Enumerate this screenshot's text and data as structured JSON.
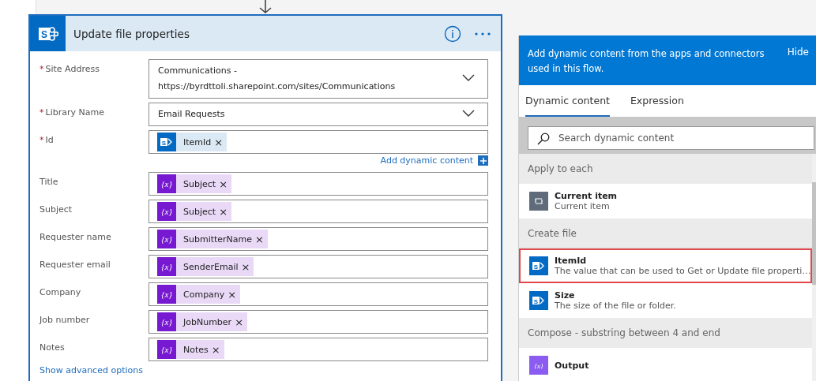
{
  "card": {
    "title": "Update file properties",
    "icon": "S",
    "fields": [
      {
        "label": "Site Address",
        "required_mark": "*",
        "kind": "dropdown",
        "lines": [
          "Communications -",
          "https://byrdttoli.sharepoint.com/sites/Communications"
        ]
      },
      {
        "label": "Library Name",
        "required_mark": "*",
        "kind": "dropdown",
        "lines": [
          "Email Requests"
        ]
      },
      {
        "label": "Id",
        "required_mark": "*",
        "kind": "tokens",
        "tokens": [
          {
            "kind": "sharepoint",
            "icon": "S",
            "text": "ItemId",
            "remove": "×"
          }
        ],
        "add_dynamic": "Add dynamic content"
      },
      {
        "label": "Title",
        "kind": "tokens",
        "tokens": [
          {
            "kind": "variable",
            "icon": "{x}",
            "text": "Subject",
            "remove": "×"
          }
        ]
      },
      {
        "label": "Subject",
        "kind": "tokens",
        "tokens": [
          {
            "kind": "variable",
            "icon": "{x}",
            "text": "Subject",
            "remove": "×"
          }
        ]
      },
      {
        "label": "Requester name",
        "kind": "tokens",
        "tokens": [
          {
            "kind": "variable",
            "icon": "{x}",
            "text": "SubmitterName",
            "remove": "×"
          }
        ]
      },
      {
        "label": "Requester email",
        "kind": "tokens",
        "tokens": [
          {
            "kind": "variable",
            "icon": "{x}",
            "text": "SenderEmail",
            "remove": "×"
          }
        ]
      },
      {
        "label": "Company",
        "kind": "tokens",
        "tokens": [
          {
            "kind": "variable",
            "icon": "{x}",
            "text": "Company",
            "remove": "×"
          }
        ]
      },
      {
        "label": "Job number",
        "kind": "tokens",
        "tokens": [
          {
            "kind": "variable",
            "icon": "{x}",
            "text": "JobNumber",
            "remove": "×"
          }
        ]
      },
      {
        "label": "Notes",
        "kind": "tokens",
        "tokens": [
          {
            "kind": "variable",
            "icon": "{x}",
            "text": "Notes",
            "remove": "×"
          }
        ]
      }
    ],
    "advanced": "Show advanced options"
  },
  "panel": {
    "message": "Add dynamic content from the apps and connectors used in this flow.",
    "hide": "Hide",
    "tabs": [
      {
        "label": "Dynamic content",
        "selected": true
      },
      {
        "label": "Expression",
        "selected": false
      }
    ],
    "search": {
      "placeholder": "Search dynamic content"
    },
    "groups": [
      {
        "title": "Apply to each",
        "items": [
          {
            "kind": "loop",
            "name": "Current item",
            "description": "Current item",
            "highlighted": false
          }
        ]
      },
      {
        "title": "Create file",
        "items": [
          {
            "kind": "sharepoint",
            "icon": "S",
            "name": "ItemId",
            "description": "The value that can be used to Get or Update file properti…",
            "highlighted": true
          },
          {
            "kind": "sharepoint",
            "icon": "S",
            "name": "Size",
            "description": "The size of the file or folder.",
            "highlighted": false
          }
        ]
      },
      {
        "title": "Compose - substring between 4 and end",
        "items": [
          {
            "kind": "variable",
            "icon": "{x}",
            "name": "Output",
            "highlighted": false
          }
        ]
      }
    ]
  }
}
